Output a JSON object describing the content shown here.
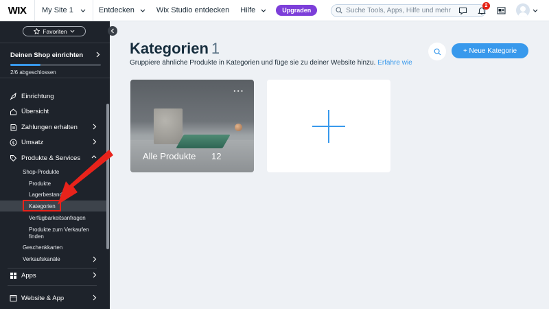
{
  "topbar": {
    "logo": "WIX",
    "site_name": "My Site 1",
    "links": [
      "Entdecken",
      "Wix Studio entdecken",
      "Hilfe"
    ],
    "upgrade_label": "Upgraden",
    "search_placeholder": "Suche Tools, Apps, Hilfe und mehr",
    "notification_count": "2",
    "icons": [
      "search-icon",
      "chat-icon",
      "bell-icon",
      "news-icon",
      "avatar"
    ]
  },
  "sidebar": {
    "favorites_label": "Favoriten",
    "setup": {
      "title": "Deinen Shop einrichten",
      "progress_text": "2/6 abgeschlossen",
      "progress_fraction": 0.333
    },
    "items": [
      {
        "label": "Einrichtung",
        "icon": "rocket-icon"
      },
      {
        "label": "Übersicht",
        "icon": "home-icon"
      },
      {
        "label": "Zahlungen erhalten",
        "icon": "payment-icon"
      },
      {
        "label": "Umsatz",
        "icon": "dollar-icon"
      },
      {
        "label": "Produkte & Services",
        "icon": "tag-icon"
      }
    ],
    "subitems": {
      "shop_produkte": "Shop-Produkte",
      "produkte": "Produkte",
      "lagerbestand": "Lagerbestand",
      "kategorien": "Kategorien",
      "verfuegbarkeit": "Verfügbarkeitsanfragen",
      "produkte_zum_verkaufen_1": "Produkte zum Verkaufen",
      "produkte_zum_verkaufen_2": "finden",
      "geschenkkarten": "Geschenkkarten",
      "verkaufskanaele": "Verkaufskanäle"
    },
    "bottom_items": [
      {
        "label": "Apps",
        "icon": "apps-icon"
      },
      {
        "label": "Website & App",
        "icon": "website-icon"
      }
    ]
  },
  "main": {
    "title": "Kategorien",
    "count": "1",
    "subtitle": "Gruppiere ähnliche Produkte in Kategorien und füge sie zu deiner Website hinzu.",
    "learn_more": "Erfahre wie",
    "new_button": "+ Neue Kategorie",
    "category_card": {
      "name": "Alle Produkte",
      "count": "12"
    }
  },
  "colors": {
    "accent": "#3899ec",
    "upgrade": "#7c3ed9",
    "sidebar_bg": "#1e232b",
    "highlight": "#e8231b"
  }
}
